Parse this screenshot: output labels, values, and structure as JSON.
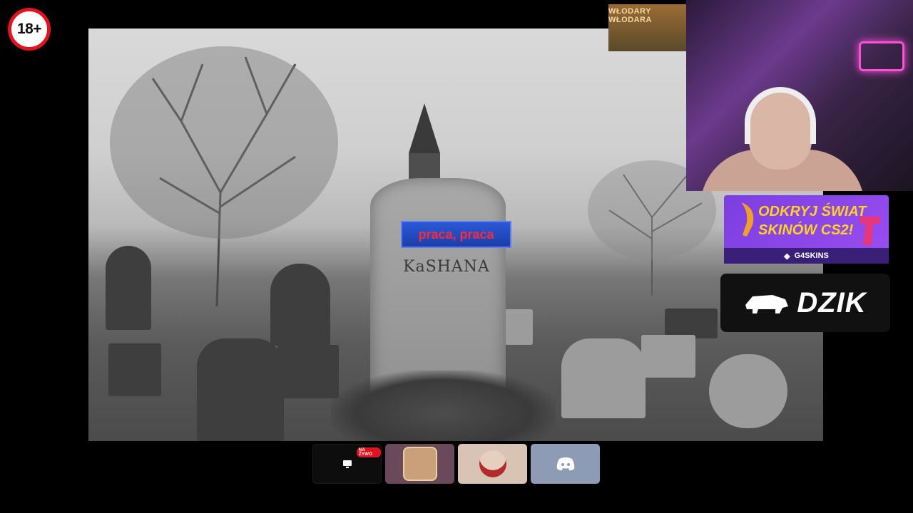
{
  "overlay": {
    "age_rating": "18+",
    "sponsor_top": "WŁODARY WŁODARA"
  },
  "stage": {
    "tomb_banner": "praca, praca",
    "tomb_inscription": "KaSHANA"
  },
  "promo": {
    "line1": "ODKRYJ ŚWIAT",
    "line2": "SKINÓW CS2!",
    "brand": "G4SKINS"
  },
  "dzik": {
    "label": "DZIK"
  },
  "controls": {
    "live_badge": "NA ŻYWO",
    "tiles": [
      "screen-share",
      "participant-1",
      "participant-2",
      "discord"
    ]
  },
  "colors": {
    "age_ring": "#e0141e",
    "promo_bg": "#8a45e8",
    "promo_text": "#ffd21f",
    "discord_tile": "#8d9bb5"
  }
}
